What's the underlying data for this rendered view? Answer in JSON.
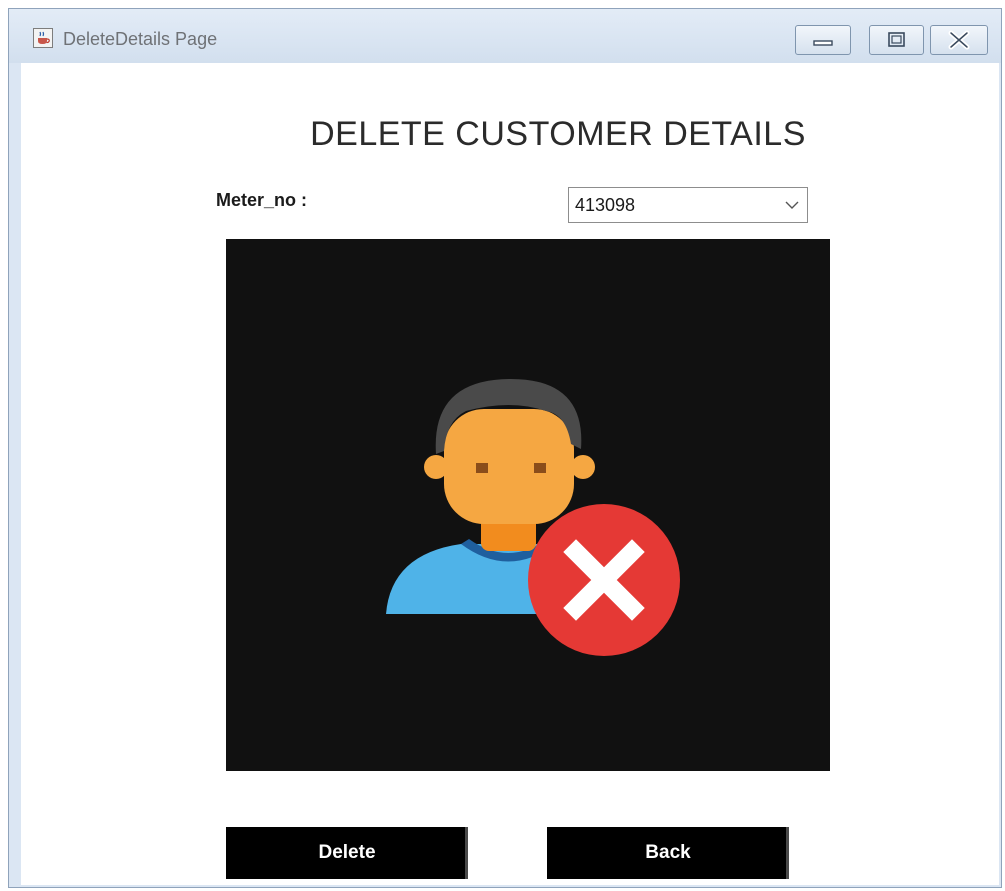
{
  "window": {
    "title": "DeleteDetails Page",
    "app_icon": "java-cup-icon"
  },
  "controls": {
    "minimize_icon": "minimize-icon",
    "maximize_icon": "maximize-icon",
    "close_icon": "close-icon"
  },
  "page": {
    "heading": "DELETE CUSTOMER DETAILS",
    "meter_label": "Meter_no :",
    "meter_value": "413098",
    "image_icon": "delete-user-icon"
  },
  "buttons": {
    "delete_label": "Delete",
    "back_label": "Back"
  },
  "colors": {
    "panel_bg": "#111111",
    "button_bg": "#000000",
    "skin": "#f5a742",
    "hair": "#4a4a4a",
    "shirt": "#4fb3e8",
    "badge": "#e53935"
  }
}
